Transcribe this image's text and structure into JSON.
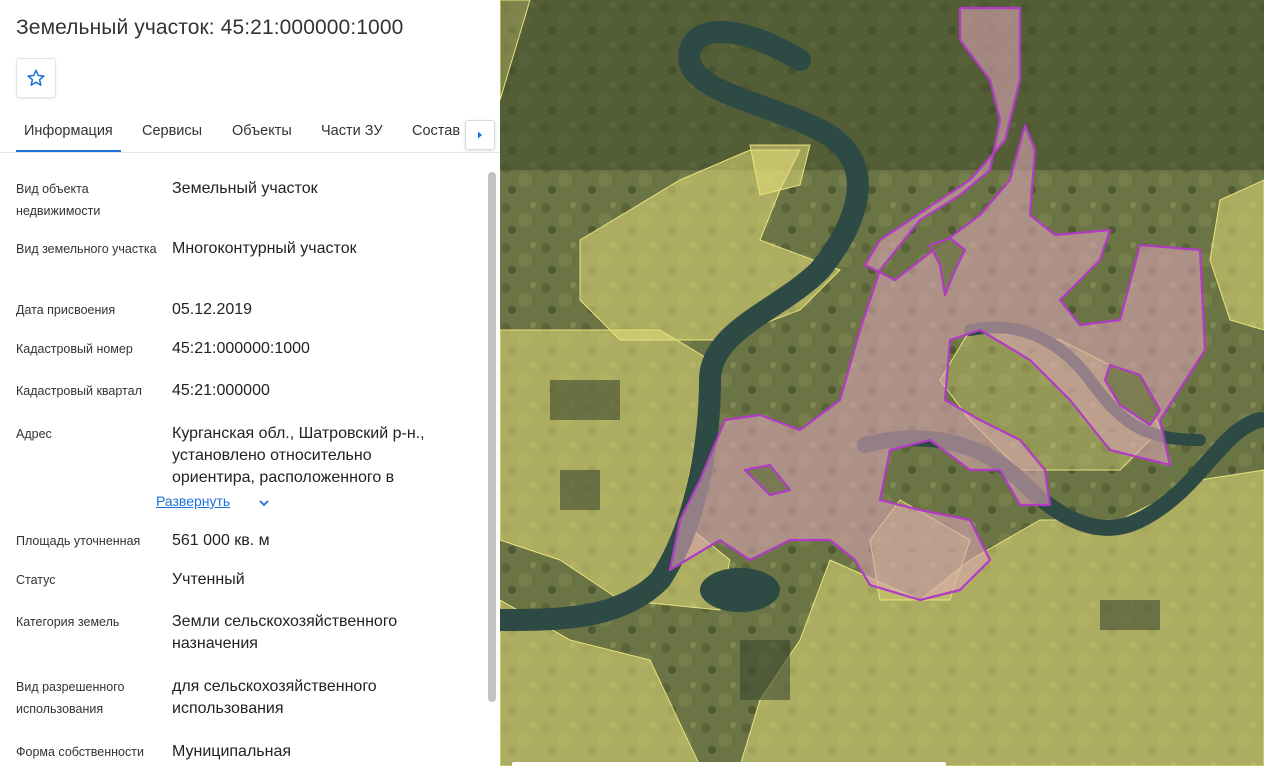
{
  "panel": {
    "title": "Земельный участок: 45:21:000000:1000",
    "favorite_icon": "star-outline-icon",
    "tabs": [
      {
        "label": "Информация",
        "active": true
      },
      {
        "label": "Сервисы",
        "active": false
      },
      {
        "label": "Объекты",
        "active": false
      },
      {
        "label": "Части ЗУ",
        "active": false
      },
      {
        "label": "Состав",
        "active": false
      }
    ],
    "tabs_next_icon": "triangle-right-icon",
    "accent_color": "#1a73d9",
    "fields": [
      {
        "label": "Вид объекта недвижимости",
        "value": "Земельный участок"
      },
      {
        "label": "Вид земельного участка",
        "value": "Многоконтурный участок"
      },
      {
        "label": "Дата присвоения",
        "value": "05.12.2019"
      },
      {
        "label": "Кадастровый номер",
        "value": "45:21:000000:1000"
      },
      {
        "label": "Кадастровый квартал",
        "value": "45:21:000000"
      },
      {
        "label": "Адрес",
        "value": "Курганская обл., Шатровский р-н., установлено относительно ориентира, расположенного в",
        "expand_label": "Развернуть"
      },
      {
        "label": "Площадь уточненная",
        "value": "561 000 кв. м"
      },
      {
        "label": "Статус",
        "value": "Учтенный"
      },
      {
        "label": "Категория земель",
        "value": "Земли сельскохозяйственного назначения"
      },
      {
        "label": "Вид разрешенного использования",
        "value": "для сельскохозяйственного использования"
      },
      {
        "label": "Форма собственности",
        "value": "Муниципальная"
      }
    ],
    "expand_icon": "chevron-down-icon"
  },
  "map": {
    "parcel_fill": "#d9a3b3",
    "parcel_stroke": "#b23bc4",
    "neighbor_fill": "#e3dd7a",
    "river_color": "#2e4a45"
  }
}
